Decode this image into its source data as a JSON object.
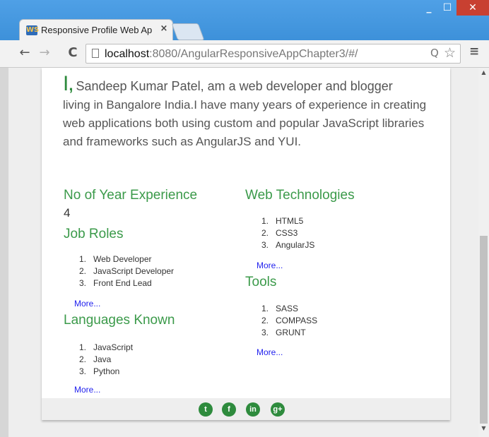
{
  "browser": {
    "tab_title": "Responsive Profile Web Ap",
    "tab_close": "×",
    "favicon_text": "WS",
    "url_host": "localhost",
    "url_rest": ":8080/AngularResponsiveAppChapter3/#/",
    "minimize": "_",
    "maximize": "☐",
    "close": "✕",
    "back": "←",
    "forward": "→",
    "reload": "C",
    "zoom_icon": "Q",
    "star_icon": "☆",
    "menu_icon": "≡",
    "scroll_up": "▲",
    "scroll_down": "▼"
  },
  "profile": {
    "intro_I": "I",
    "intro_comma": ",",
    "intro_first": "Sandeep Kumar Patel, am a web developer and blogger",
    "intro_rest": "living in Bangalore India.I have many years of experience in creating web applications both using custom and popular JavaScript libraries and frameworks such as AngularJS and YUI.",
    "experience_heading": "No of Year Experience",
    "experience_value": "4",
    "job_roles_heading": "Job Roles",
    "job_roles": [
      "Web Developer",
      "JavaScript Developer",
      "Front End Lead"
    ],
    "languages_heading": "Languages Known",
    "languages": [
      "JavaScript",
      "Java",
      "Python"
    ],
    "web_tech_heading": "Web Technologies",
    "web_tech": [
      "HTML5",
      "CSS3",
      "AngularJS"
    ],
    "tools_heading": "Tools",
    "tools": [
      "SASS",
      "COMPASS",
      "GRUNT"
    ],
    "more_label": "More..."
  },
  "footer": {
    "social_icons": [
      {
        "name": "twitter",
        "glyph": "t"
      },
      {
        "name": "facebook",
        "glyph": "f"
      },
      {
        "name": "linkedin",
        "glyph": "in"
      },
      {
        "name": "google-plus",
        "glyph": "g+"
      }
    ]
  },
  "colors": {
    "accent_green": "#3b9a4a",
    "link_blue": "#2222ee",
    "titlebar_blue": "#3b8fd8"
  }
}
